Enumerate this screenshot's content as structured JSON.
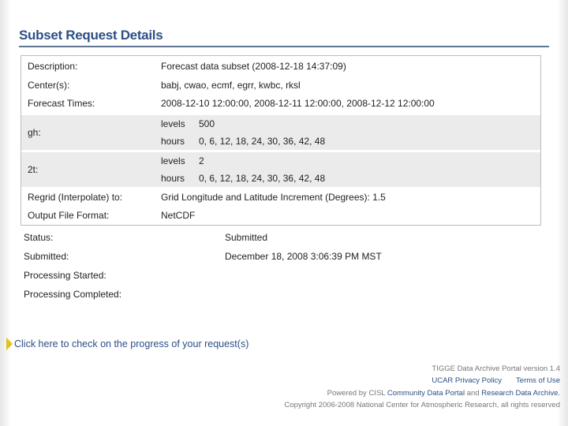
{
  "page": {
    "title": "Subset Request Details"
  },
  "details": {
    "description_label": "Description:",
    "description_value": "Forecast data subset (2008-12-18 14:37:09)",
    "centers_label": "Center(s):",
    "centers_value": "babj, cwao, ecmf, egrr, kwbc, rksl",
    "forecast_label": "Forecast Times:",
    "forecast_value": "2008-12-10 12:00:00, 2008-12-11 12:00:00, 2008-12-12 12:00:00",
    "gh_label": "gh:",
    "gh_levels_key": "levels",
    "gh_levels_val": "500",
    "gh_hours_key": "hours",
    "gh_hours_val": "0, 6, 12, 18, 24, 30, 36, 42, 48",
    "t2_label": "2t:",
    "t2_levels_key": "levels",
    "t2_levels_val": "2",
    "t2_hours_key": "hours",
    "t2_hours_val": "0, 6, 12, 18, 24, 30, 36, 42, 48",
    "regrid_label": "Regrid (Interpolate) to:",
    "regrid_value": "Grid Longitude and Latitude Increment (Degrees): 1.5",
    "format_label": "Output File Format:",
    "format_value": "NetCDF"
  },
  "status": {
    "status_label": "Status:",
    "status_value": "Submitted",
    "submitted_label": "Submitted:",
    "submitted_value": "December 18, 2008 3:06:39 PM MST",
    "started_label": "Processing Started:",
    "completed_label": "Processing Completed:"
  },
  "progress_link": "Click here to check on the progress of your request(s)",
  "footer": {
    "version": "TIGGE Data Archive Portal version 1.4",
    "privacy": "UCAR Privacy Policy",
    "terms": "Terms of Use",
    "powered_prefix": "Powered by CISL",
    "community_portal": "Community Data Portal",
    "and": "and",
    "research_archive": "Research Data Archive.",
    "copyright": "Copyright 2006-2008 National Center for Atmospheric Research, all rights reserved"
  },
  "colors": {
    "title": "#2c4f86",
    "rule": "#5d7593",
    "shade": "#ebebeb",
    "arrow": "#e3c21a"
  }
}
